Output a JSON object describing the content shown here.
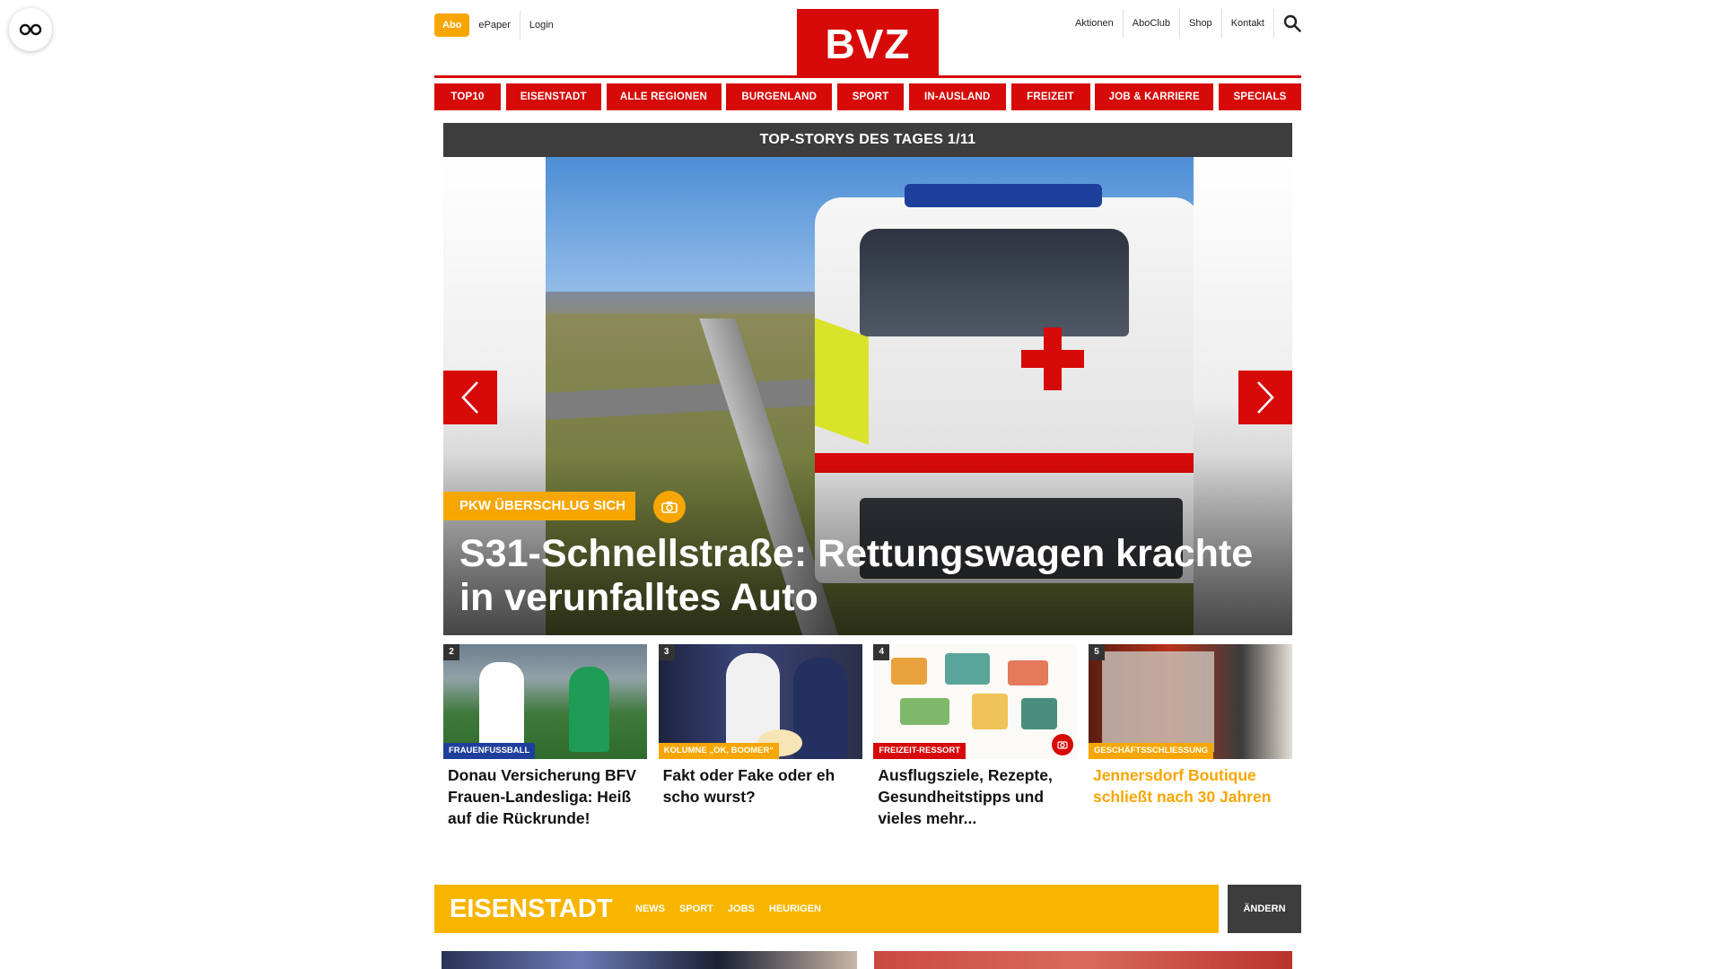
{
  "header": {
    "abo_label": "Abo",
    "left_links": [
      "ePaper",
      "Login"
    ],
    "logo_text": "BVZ",
    "right_links": [
      "Aktionen",
      "AboClub",
      "Shop",
      "Kontakt"
    ]
  },
  "nav": {
    "items": [
      "TOP10",
      "EISENSTADT",
      "ALLE REGIONEN",
      "BURGENLAND",
      "SPORT",
      "IN-AUSLAND",
      "FREIZEIT",
      "JOB & KARRIERE",
      "SPECIALS"
    ]
  },
  "slider": {
    "title": "TOP-STORYS DES TAGES 1/11",
    "hero": {
      "kicker": "PKW ÜBERSCHLUG SICH",
      "title": "S31-Schnellstraße: Rettungswagen krachte in verunfalltes Auto"
    }
  },
  "teasers": [
    {
      "number": "2",
      "tag": "FRAUENFUSSBALL",
      "tag_color": "#1f3f9c",
      "title": "Donau Versicherung BFV Frauen-Landesliga: Heiß auf die Rückrunde!",
      "title_color": "#111111"
    },
    {
      "number": "3",
      "tag": "KOLUMNE „OK, BOOMER“",
      "tag_color": "#f7a600",
      "title": "Fakt oder Fake oder eh scho wurst?",
      "title_color": "#111111"
    },
    {
      "number": "4",
      "tag": "FREIZEIT-RESSORT",
      "tag_color": "#d70a0a",
      "title": "Ausflugsziele, Rezepte, Gesundheitstipps und vieles mehr...",
      "title_color": "#111111"
    },
    {
      "number": "5",
      "tag": "GESCHÄFTSSCHLIESSUNG",
      "tag_color": "#f7a600",
      "title": "Jennersdorf Boutique schließt nach 30 Jahren",
      "title_color": "#f7a600"
    }
  ],
  "section": {
    "title": "EISENSTADT",
    "links": [
      "NEWS",
      "SPORT",
      "JOBS",
      "HEURIGEN"
    ],
    "change_label": "ÄNDERN"
  },
  "colors": {
    "brand_red": "#d70a0a",
    "accent_yellow": "#f7a600",
    "dark_bar": "#3d3d3d"
  }
}
